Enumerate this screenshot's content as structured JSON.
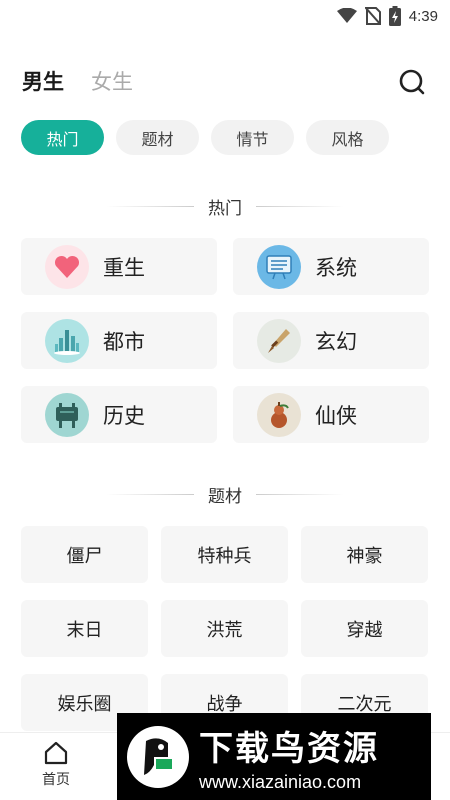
{
  "status_bar": {
    "time": "4:39"
  },
  "header": {
    "tabs": [
      {
        "label": "男生",
        "active": true
      },
      {
        "label": "女生",
        "active": false
      }
    ]
  },
  "category_chips": [
    {
      "label": "热门",
      "active": true
    },
    {
      "label": "题材",
      "active": false
    },
    {
      "label": "情节",
      "active": false
    },
    {
      "label": "风格",
      "active": false
    }
  ],
  "hot_section": {
    "title": "热门",
    "items": [
      {
        "label": "重生",
        "icon": "heart-icon",
        "color": "#f2637b"
      },
      {
        "label": "系统",
        "icon": "screen-icon",
        "color": "#4a9fd8"
      },
      {
        "label": "都市",
        "icon": "city-tower-icon",
        "color": "#59c2c8"
      },
      {
        "label": "玄幻",
        "icon": "dagger-icon",
        "color": "#8b5a2b"
      },
      {
        "label": "历史",
        "icon": "bronze-cauldron-icon",
        "color": "#3a6f6a"
      },
      {
        "label": "仙侠",
        "icon": "gourd-icon",
        "color": "#b5562b"
      }
    ]
  },
  "theme_section": {
    "title": "题材",
    "items": [
      "僵尸",
      "特种兵",
      "神豪",
      "末日",
      "洪荒",
      "穿越",
      "娱乐圈",
      "战争",
      "二次元"
    ]
  },
  "bottom_nav": {
    "home_label": "首页"
  },
  "watermark": {
    "title": "下载鸟资源",
    "url": "www.xiazainiao.com"
  },
  "colors": {
    "accent": "#16b09a",
    "card_bg": "#f6f6f6",
    "chip_bg": "#f2f2f2"
  }
}
